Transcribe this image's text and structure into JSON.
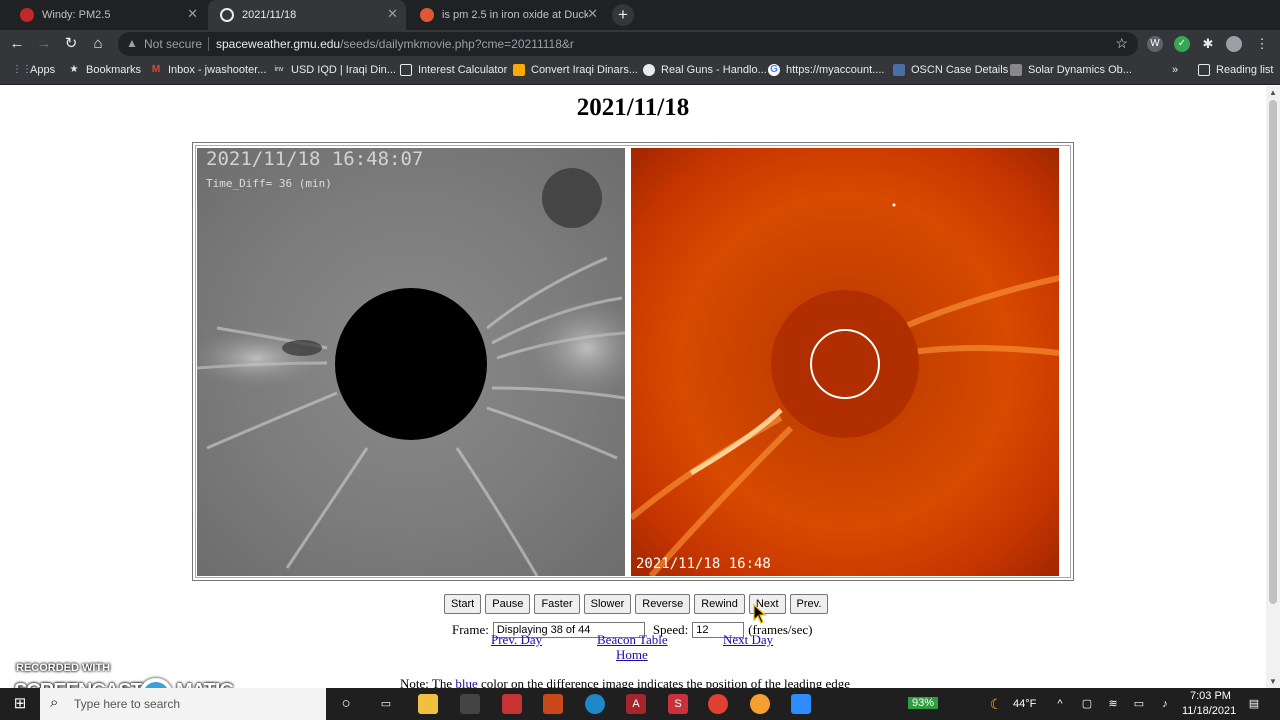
{
  "browser": {
    "tabs": [
      {
        "title": "Windy: PM2.5",
        "color": "#e04040"
      },
      {
        "title": "2021/11/18",
        "color": "#e8eaed"
      },
      {
        "title": "is pm 2.5 in iron oxide at DuckDu",
        "color": "#de5833"
      }
    ],
    "security_label": "Not secure",
    "url_host": "spaceweather.gmu.edu",
    "url_path": "/seeds/dailymkmovie.php?cme=20211118&r",
    "bookmarks": [
      {
        "label": "Apps",
        "icon": "apps-grid-icon"
      },
      {
        "label": "Bookmarks",
        "icon": "star-icon"
      },
      {
        "label": "Inbox - jwashooter...",
        "icon": "gmail-icon"
      },
      {
        "label": "USD IQD | Iraqi Din...",
        "icon": "inv-icon"
      },
      {
        "label": "Interest Calculator",
        "icon": "calculator-icon"
      },
      {
        "label": "Convert Iraqi Dinars...",
        "icon": "exchange-icon"
      },
      {
        "label": "Real Guns - Handlo...",
        "icon": "globe-icon"
      },
      {
        "label": "https://myaccount....",
        "icon": "google-icon"
      },
      {
        "label": "OSCN Case Details",
        "icon": "shield-icon"
      },
      {
        "label": "Solar Dynamics Ob...",
        "icon": "sdo-icon"
      }
    ],
    "more_bookmarks": "»",
    "reading_list": "Reading list"
  },
  "page": {
    "title": "2021/11/18",
    "left_image": {
      "timestamp": "2021/11/18 16:48:07",
      "time_diff": "Time_Diff= 36 (min)"
    },
    "right_image": {
      "timestamp": "2021/11/18 16:48"
    },
    "buttons": [
      "Start",
      "Pause",
      "Faster",
      "Slower",
      "Reverse",
      "Rewind",
      "Next",
      "Prev."
    ],
    "frame_label": "Frame:",
    "frame_value": "Displaying 38 of 44",
    "speed_label": "Speed:",
    "speed_value": "12",
    "speed_unit": "(frames/sec)",
    "links": {
      "prev_day": "Prev. Day",
      "beacon_table": "Beacon Table",
      "next_day": "Next Day",
      "home": "Home"
    },
    "note_prefix": "Note: The ",
    "note_blue": "blue",
    "note_suffix": " color on the difference image indicates the position of the leading edge"
  },
  "watermark": {
    "line1": "RECORDED WITH",
    "line2": "SCREENCAST",
    "line3": "MATIC"
  },
  "taskbar": {
    "search_placeholder": "Type here to search",
    "battery": "93%",
    "weather": "44°F",
    "time": "7:03 PM",
    "date": "11/18/2021"
  }
}
